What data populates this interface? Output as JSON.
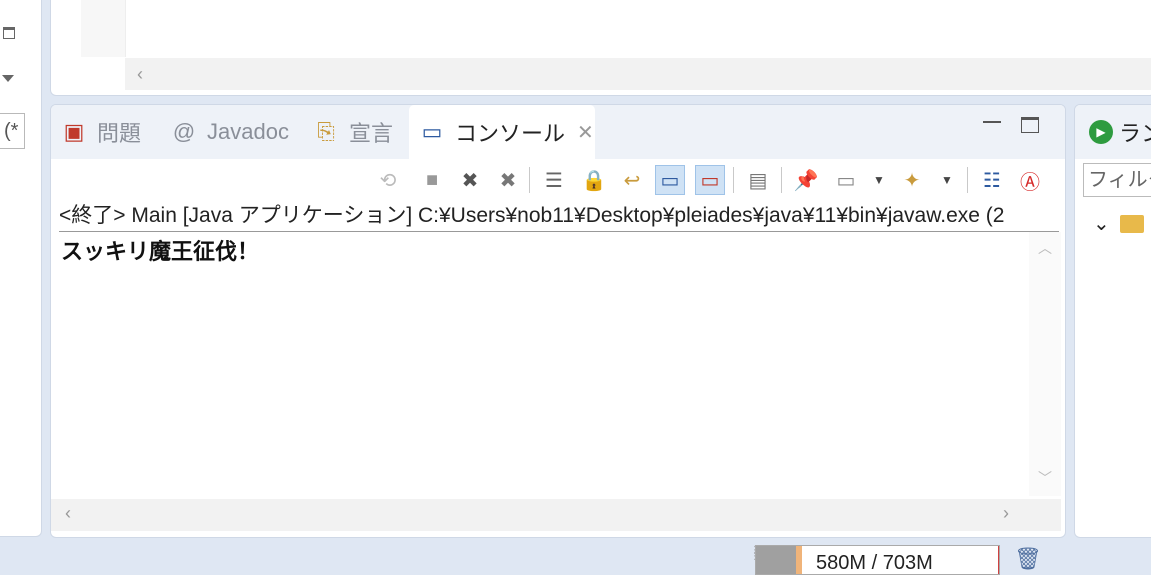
{
  "left_pane": {
    "input_text": "(*"
  },
  "console_view": {
    "tabs": [
      {
        "label": "問題",
        "icon": "problems-icon"
      },
      {
        "label": "Javadoc",
        "icon": "at-icon"
      },
      {
        "label": "宣言",
        "icon": "declaration-icon"
      },
      {
        "label": "コンソール",
        "icon": "console-icon",
        "active": true
      }
    ],
    "title": "<終了> Main [Java アプリケーション] C:¥Users¥nob11¥Desktop¥pleiades¥java¥11¥bin¥javaw.exe (2",
    "output": "スッキリ魔王征伐！"
  },
  "right_pane": {
    "tab_label": "ラン",
    "filter_placeholder": "フィルタ"
  },
  "status_bar": {
    "heap": "580M / 703M"
  },
  "colors": {
    "accent": "#cfe2f5",
    "background": "#dfe7f3"
  }
}
